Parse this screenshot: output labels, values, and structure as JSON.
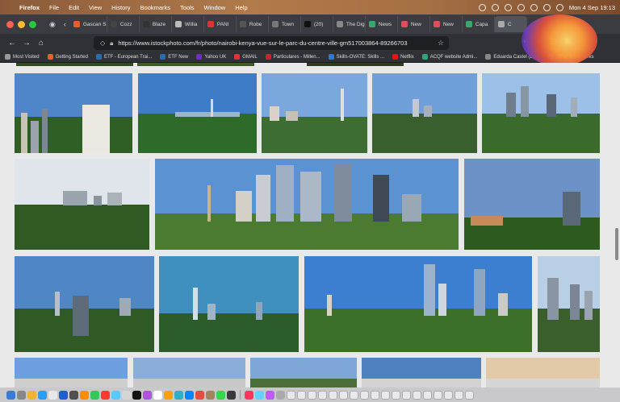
{
  "menubar": {
    "app": "Firefox",
    "items": [
      "File",
      "Edit",
      "View",
      "History",
      "Bookmarks",
      "Tools",
      "Window",
      "Help"
    ],
    "clock": "Mon 4 Sep  19:13"
  },
  "tabs": [
    {
      "label": "Gascan S",
      "color": "#e85d27"
    },
    {
      "label": "Cozz",
      "color": "#444"
    },
    {
      "label": "Blaze",
      "color": "#333"
    },
    {
      "label": "Willia",
      "color": "#bbb"
    },
    {
      "label": "PANI",
      "color": "#d33"
    },
    {
      "label": "Robe",
      "color": "#555"
    },
    {
      "label": "Town",
      "color": "#777"
    },
    {
      "label": "(20)",
      "color": "#111"
    },
    {
      "label": "The Digit",
      "color": "#888"
    },
    {
      "label": "News",
      "color": "#3aa76d"
    },
    {
      "label": "New",
      "color": "#e04e5a"
    },
    {
      "label": "New",
      "color": "#e04e5a"
    },
    {
      "label": "Capa",
      "color": "#3aa76d"
    },
    {
      "label": "C",
      "color": "#aaa"
    }
  ],
  "url": "https://www.istockphoto.com/fr/photo/nairobi-kenya-vue-sur-le-parc-du-centre-ville-gm517003864-89266703",
  "bookmarks": [
    {
      "label": "Most Visited",
      "color": "#999"
    },
    {
      "label": "Getting Started",
      "color": "#e85d27"
    },
    {
      "label": "ETF - European Trai...",
      "color": "#2b6cb0"
    },
    {
      "label": "ETF New",
      "color": "#2b6cb0"
    },
    {
      "label": "Yahoo UK",
      "color": "#6b2bd0"
    },
    {
      "label": "GMAIL",
      "color": "#d33"
    },
    {
      "label": "Particulares - Millen...",
      "color": "#c23"
    },
    {
      "label": "Skills-OVATE: Skills ...",
      "color": "#2b7bd0"
    },
    {
      "label": "Netflix",
      "color": "#e11"
    },
    {
      "label": "ACQF website Admi...",
      "color": "#2a7"
    },
    {
      "label": "Eduarda Castel (Eu...",
      "color": "#888"
    },
    {
      "label": "Other Bookmarks",
      "color": "#888"
    }
  ],
  "photos": [
    {
      "id": "p1",
      "sky": "#4f86c9",
      "land": "#2f5f24"
    },
    {
      "id": "p2",
      "sky": "#3e7cc8",
      "land": "#2e6a2a"
    },
    {
      "id": "p3",
      "sky": "#7aa7dd",
      "land": "#3e6d33"
    },
    {
      "id": "p4",
      "sky": "#6fa0d9",
      "land": "#3a5f2e"
    },
    {
      "id": "p5",
      "sky": "#9cc0e8",
      "land": "#3b6b2c"
    },
    {
      "id": "p6",
      "sky": "#dfe5ea",
      "land": "#2f5a24"
    },
    {
      "id": "p7",
      "sky": "#5b92d2",
      "land": "#4a7b30"
    },
    {
      "id": "p8",
      "sky": "#6c92c7",
      "land": "#2c5a1f"
    },
    {
      "id": "p9",
      "sky": "#4f87c6",
      "land": "#2f5a26"
    },
    {
      "id": "p10",
      "sky": "#3f8fbf",
      "land": "#2c5c2a"
    },
    {
      "id": "p11",
      "sky": "#3c7fd0",
      "land": "#3b6f2a"
    },
    {
      "id": "p12",
      "sky": "#b9cfe6",
      "land": "#3a5e2c"
    },
    {
      "id": "p13",
      "sky": "#6e9fe0",
      "land": "#cfcfcf"
    },
    {
      "id": "p14",
      "sky": "#8aaed8",
      "land": "#c7c7c7"
    },
    {
      "id": "p15",
      "sky": "#7ea6d6",
      "land": "#4a6d3a"
    },
    {
      "id": "p16",
      "sky": "#4f80bf",
      "land": "#d2d2d2"
    },
    {
      "id": "p17",
      "sky": "#e2c9a8",
      "land": "#d6d6d6"
    }
  ]
}
